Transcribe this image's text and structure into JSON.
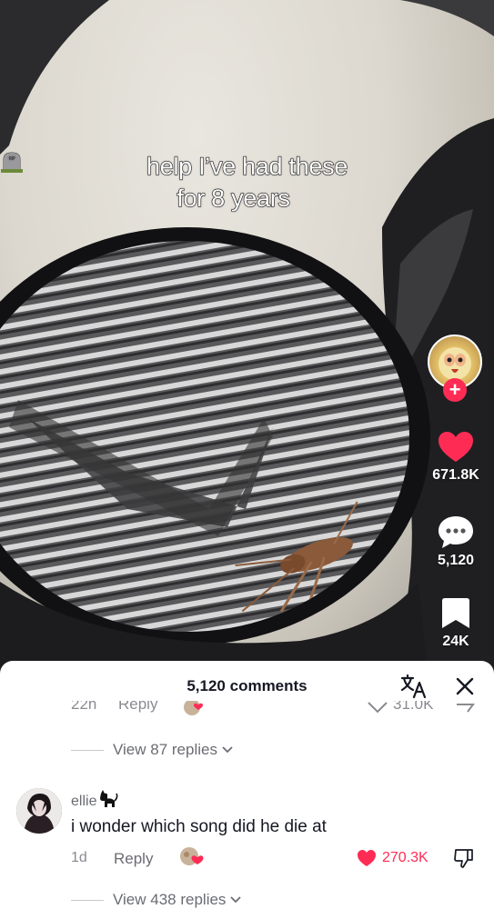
{
  "video": {
    "caption_line1": "help I’ve had these",
    "caption_line2": "for 8 years",
    "caption_emoji": "headstone-icon"
  },
  "rail": {
    "likes": "671.8K",
    "comments": "5,120",
    "saves": "24K",
    "follow_icon": "plus-icon"
  },
  "comments_sheet": {
    "title": "5,120 comments",
    "translate_icon": "translate-icon",
    "close_icon": "close-icon",
    "prev_partial": {
      "time": "22h",
      "reply": "Reply",
      "likes": "31.0K"
    },
    "view_replies_1": "View 87 replies",
    "comment": {
      "username": "ellie",
      "username_emoji": "black-cat-icon",
      "text": "i wonder which song did he die at",
      "time": "1d",
      "reply": "Reply",
      "likes": "270.3K",
      "liked": true
    },
    "view_replies_2": "View 438 replies"
  },
  "colors": {
    "accent": "#fe2c55",
    "text_primary": "#161823",
    "text_secondary": "#8a8b91"
  }
}
